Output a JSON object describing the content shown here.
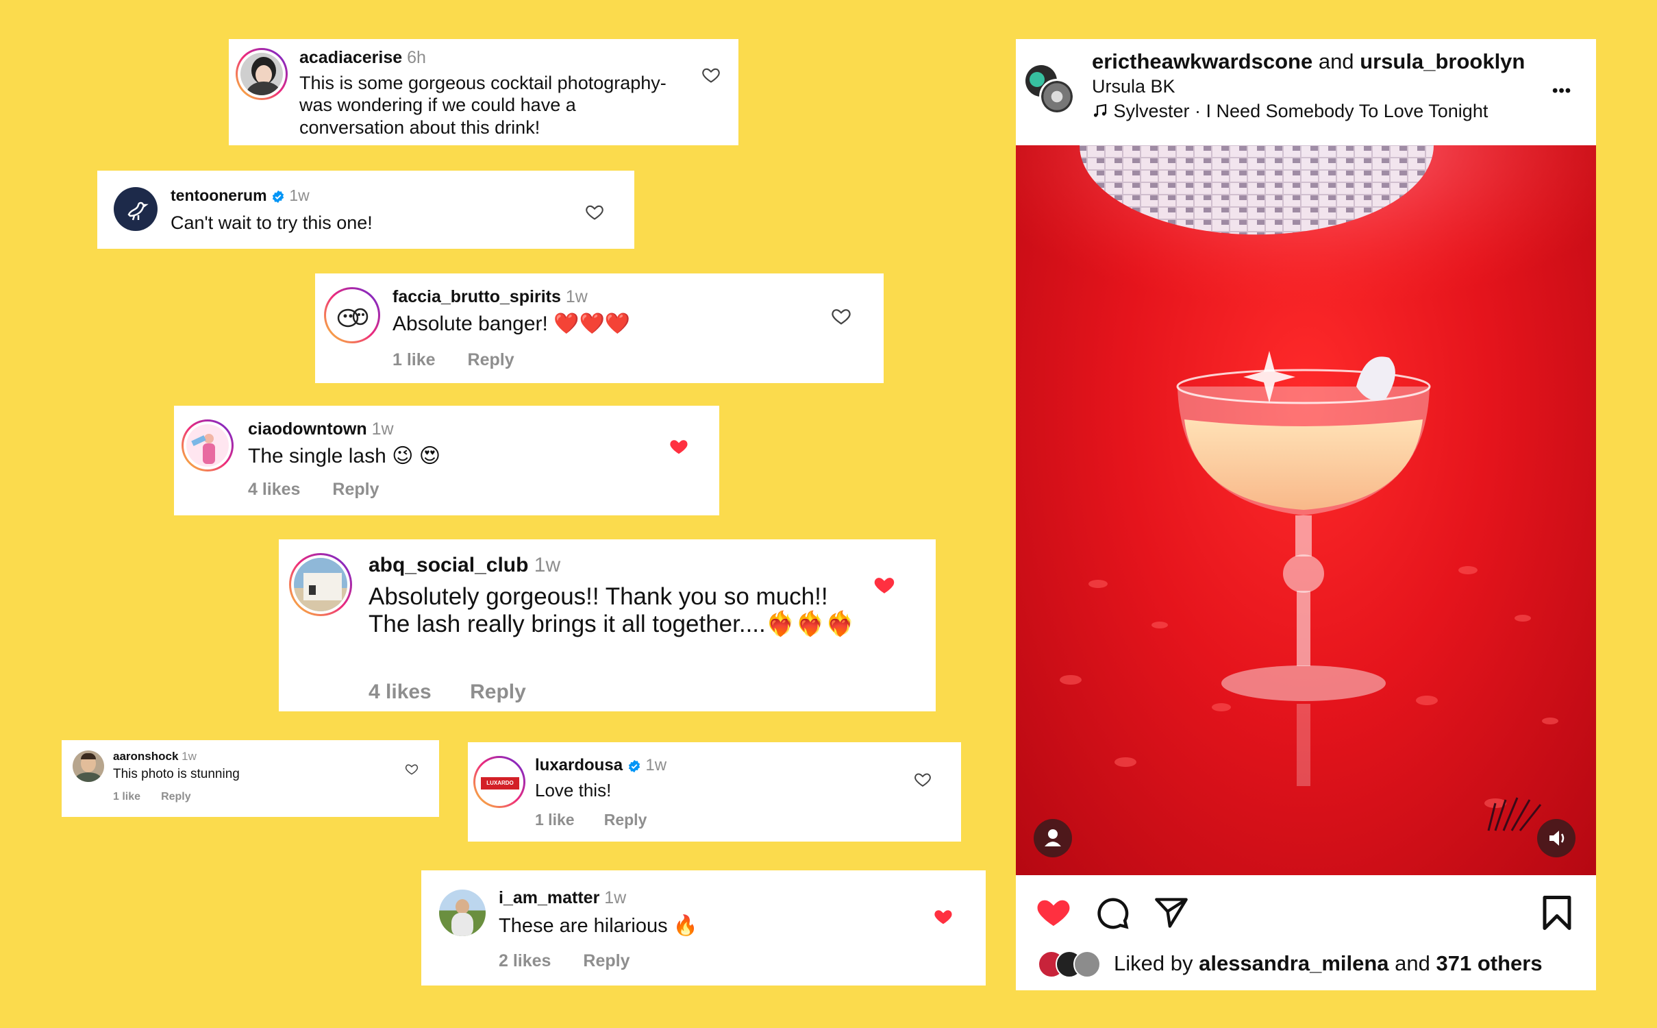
{
  "comments": [
    {
      "username": "acadiacerise",
      "time": "6h",
      "text": "This is some gorgeous cocktail photography- was wondering if we could have a conversation about this drink!",
      "liked": false
    },
    {
      "username": "tentoonerum",
      "verified": true,
      "time": "1w",
      "text": "Can't wait to try this one!",
      "liked": false
    },
    {
      "username": "faccia_brutto_spirits",
      "time": "1w",
      "text": "Absolute banger! ❤️❤️❤️",
      "likes": "1 like",
      "reply": "Reply",
      "liked": false
    },
    {
      "username": "ciaodowntown",
      "time": "1w",
      "text": "The single lash 😉 😍",
      "likes": "4 likes",
      "reply": "Reply",
      "liked": true
    },
    {
      "username": "abq_social_club",
      "time": "1w",
      "text": "Absolutely gorgeous!! Thank you so much!! The lash really brings it all together....❤️‍🔥❤️‍🔥❤️‍🔥",
      "likes": "4 likes",
      "reply": "Reply",
      "liked": true
    },
    {
      "username": "aaronshock",
      "time": "1w",
      "text": "This photo is stunning",
      "likes": "1 like",
      "reply": "Reply",
      "liked": false
    },
    {
      "username": "luxardousa",
      "verified": true,
      "time": "1w",
      "text": "Love this!",
      "likes": "1 like",
      "reply": "Reply",
      "liked": false
    },
    {
      "username": "i_am_matter",
      "time": "1w",
      "text": "These are hilarious 🔥",
      "likes": "2 likes",
      "reply": "Reply",
      "liked": true
    }
  ],
  "post": {
    "user1": "erictheawkwardscone",
    "and": "and",
    "user2": "ursula_brooklyn",
    "location": "Ursula BK",
    "music": "Sylvester · I Need Somebody To Love Tonight",
    "more": "•••",
    "liked_prefix": "Liked by",
    "liked_user": "alessandra_milena",
    "liked_and": "and",
    "liked_others": "371 others"
  },
  "colors": {
    "background": "#fbdb4d",
    "like_red": "#ff3040",
    "verified_blue": "#0095f6",
    "photo_red": "#e5141c"
  },
  "icons": [
    "heart-outline-icon",
    "heart-filled-icon",
    "verified-badge-icon",
    "music-note-icon",
    "more-icon",
    "comment-icon",
    "share-icon",
    "bookmark-icon",
    "user-tag-icon",
    "sound-icon"
  ]
}
